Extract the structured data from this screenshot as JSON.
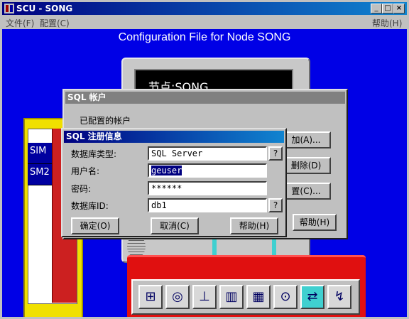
{
  "window": {
    "title": "SCU - SONG",
    "buttons": {
      "minimize": "_",
      "maximize": "□",
      "close": "×"
    }
  },
  "menu": {
    "file": "文件(F)",
    "config": "配置(C)",
    "help": "帮助(H)"
  },
  "main": {
    "heading": "Configuration File for Node SONG",
    "screen_text": "节点:SONG",
    "rack_labels": [
      "SIM",
      "SM2"
    ]
  },
  "sql_account_dialog": {
    "title": "SQL 帐户",
    "configured_label": "已配置的帐户",
    "add_button": "加(A)...",
    "delete_button": "删除(D)",
    "configure_button": "置(C)...",
    "help_button": "帮助(H)"
  },
  "sql_register_dialog": {
    "title": "SQL 注册信息",
    "db_type_label": "数据库类型:",
    "db_type_value": "SQL Server",
    "username_label": "用户名:",
    "username_value": "geuser",
    "password_label": "密码:",
    "password_value": "******",
    "db_id_label": "数据库ID:",
    "db_id_value": "db1",
    "question_mark": "?",
    "ok_button": "确定(O)",
    "cancel_button": "取消(C)",
    "help_button": "帮助(H)"
  },
  "toolbox": {
    "tools": [
      "tree-icon",
      "cd-icon",
      "network-icon",
      "library-icon",
      "panel-icon",
      "lock-icon",
      "sql-icon",
      "config-icon"
    ],
    "selected_index": 6
  },
  "colors": {
    "background": "#0000e6",
    "titlebar": "#000080",
    "toolbox": "#e01010",
    "rack": "#f0e000"
  }
}
